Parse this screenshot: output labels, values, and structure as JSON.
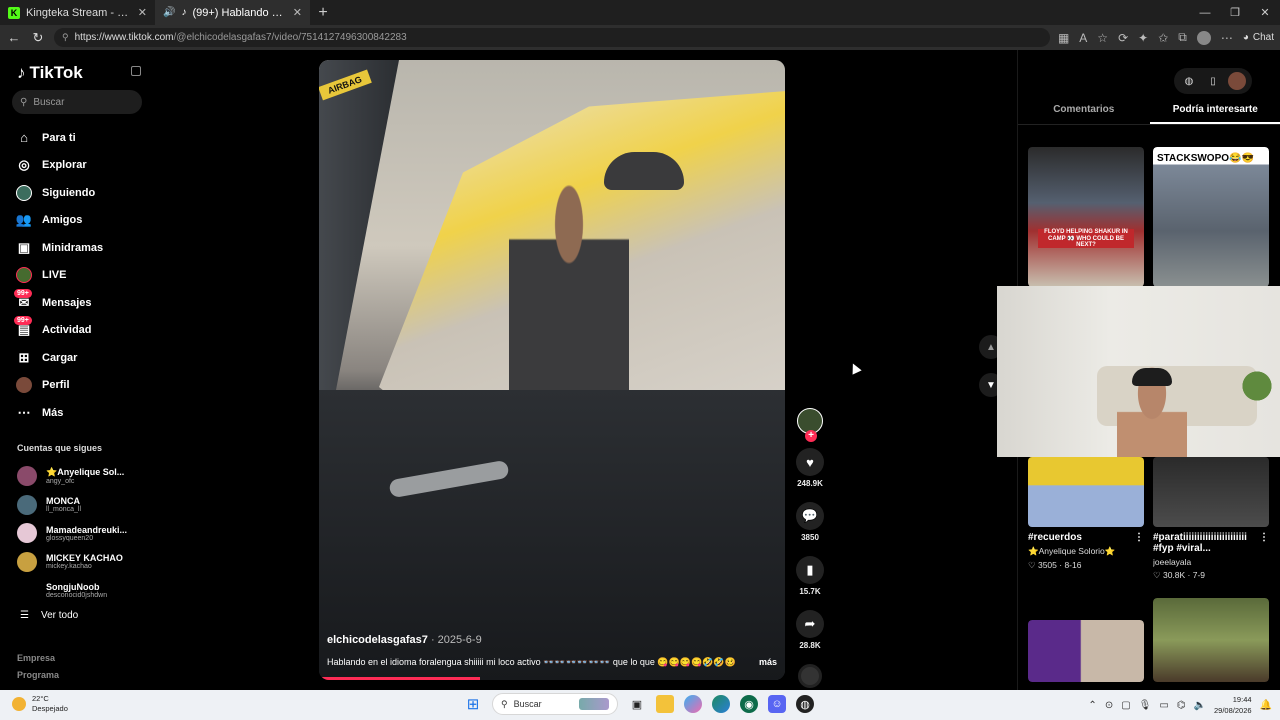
{
  "browser": {
    "tabs": [
      {
        "title": "Kingteka Stream - Watch Live on K",
        "icon": "kick-icon"
      },
      {
        "title": "(99+) Hablando en el Idioma F",
        "icon": "tiktok-icon"
      }
    ],
    "url_host": "https://www.tiktok.com",
    "url_path": "/@elchicodelasgafas7/video/7514127496300842283",
    "chat_label": "Chat"
  },
  "sidebar": {
    "logo": "TikTok",
    "search_placeholder": "Buscar",
    "nav": [
      {
        "label": "Para ti",
        "icon": "home-icon"
      },
      {
        "label": "Explorar",
        "icon": "compass-icon"
      },
      {
        "label": "Siguiendo",
        "icon": "following-avatar-icon"
      },
      {
        "label": "Amigos",
        "icon": "friends-icon"
      },
      {
        "label": "Minidramas",
        "icon": "minidramas-icon"
      },
      {
        "label": "LIVE",
        "icon": "live-icon"
      },
      {
        "label": "Mensajes",
        "icon": "messages-icon",
        "badge": "99+"
      },
      {
        "label": "Actividad",
        "icon": "activity-icon",
        "badge": "99+"
      },
      {
        "label": "Cargar",
        "icon": "upload-icon"
      },
      {
        "label": "Perfil",
        "icon": "profile-icon"
      },
      {
        "label": "Más",
        "icon": "more-icon"
      }
    ],
    "following_heading": "Cuentas que sigues",
    "following": [
      {
        "name": "⭐Anyelique Sol...",
        "user": "angy_ofc"
      },
      {
        "name": "MONCA",
        "user": "ll_monca_ll"
      },
      {
        "name": "Mamadeandreuki...",
        "user": "glossyqueen20"
      },
      {
        "name": "MICKEY KACHAO",
        "user": "mickey.kachao"
      },
      {
        "name": "SongjuNoob",
        "user": "desconocid0jshdwn"
      }
    ],
    "see_all": "Ver todo",
    "footer": [
      "Empresa",
      "Programa"
    ]
  },
  "video": {
    "overlay_text": "AIRBAG",
    "author": "elchicodelasgafas7",
    "date": "· 2025-6-9",
    "caption": "Hablando en el idioma foralengua shiiiii mi loco activo 👓👓👓👓👓👓 que lo que 😋😋😋😋🤣🤣🥴",
    "more": "más",
    "progress": 0.34
  },
  "actions": {
    "likes": "248.9K",
    "comments": "3850",
    "saves": "15.7K",
    "shares": "28.8K"
  },
  "right_panel": {
    "tabs": [
      "Comentarios",
      "Podría interesarte"
    ],
    "active_tab": 1,
    "cards": [
      {
        "thumb_text": "FLOYD HELPING SHAKUR IN CAMP 👀 WHO COULD BE NEXT?"
      },
      {
        "thumb_text": "STACKSWOPO😂😎"
      },
      {
        "title": "#recuerdos",
        "author": "⭐Anyelique Solorio⭐",
        "stats": "♡ 3505 · 8-16"
      },
      {
        "title": "#paratiiiiiiiiiiiiiiiiiiiiiii #fyp #viral...",
        "author": "joeelayala",
        "stats": "♡ 30.8K · 7-9"
      }
    ]
  },
  "taskbar": {
    "temp": "22°C",
    "weather": "Despejado",
    "search": "Buscar",
    "time": "19:44",
    "date": "29/08/2026"
  }
}
